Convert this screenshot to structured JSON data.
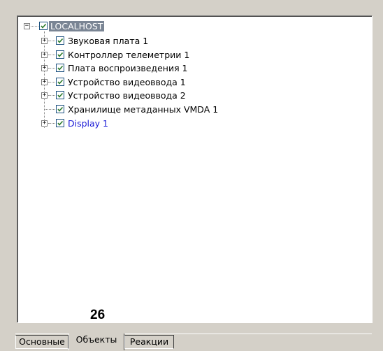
{
  "tree": {
    "root": {
      "label": "LOCALHOST",
      "checked": true,
      "expanded": true
    },
    "children": [
      {
        "label": "Звуковая плата 1",
        "checked": true,
        "expandable": true,
        "link": false
      },
      {
        "label": "Контроллер телеметрии 1",
        "checked": true,
        "expandable": true,
        "link": false
      },
      {
        "label": "Плата воспроизведения 1",
        "checked": true,
        "expandable": true,
        "link": false
      },
      {
        "label": "Устройство видеоввода 1",
        "checked": true,
        "expandable": true,
        "link": false
      },
      {
        "label": "Устройство видеоввода 2",
        "checked": true,
        "expandable": true,
        "link": false
      },
      {
        "label": "Хранилище метаданных VMDA 1",
        "checked": true,
        "expandable": false,
        "link": false
      },
      {
        "label": "Display 1",
        "checked": true,
        "expandable": true,
        "link": true
      }
    ]
  },
  "page_number": "26",
  "tabs": [
    {
      "label": "Основные",
      "active": false
    },
    {
      "label": "Объекты",
      "active": true
    },
    {
      "label": "Реакции",
      "active": false
    }
  ],
  "colors": {
    "window_bg": "#d4d0c8",
    "selection_bg": "#7a8594",
    "link_text": "#1a1ad6",
    "checkbox_border": "#1c5180"
  }
}
